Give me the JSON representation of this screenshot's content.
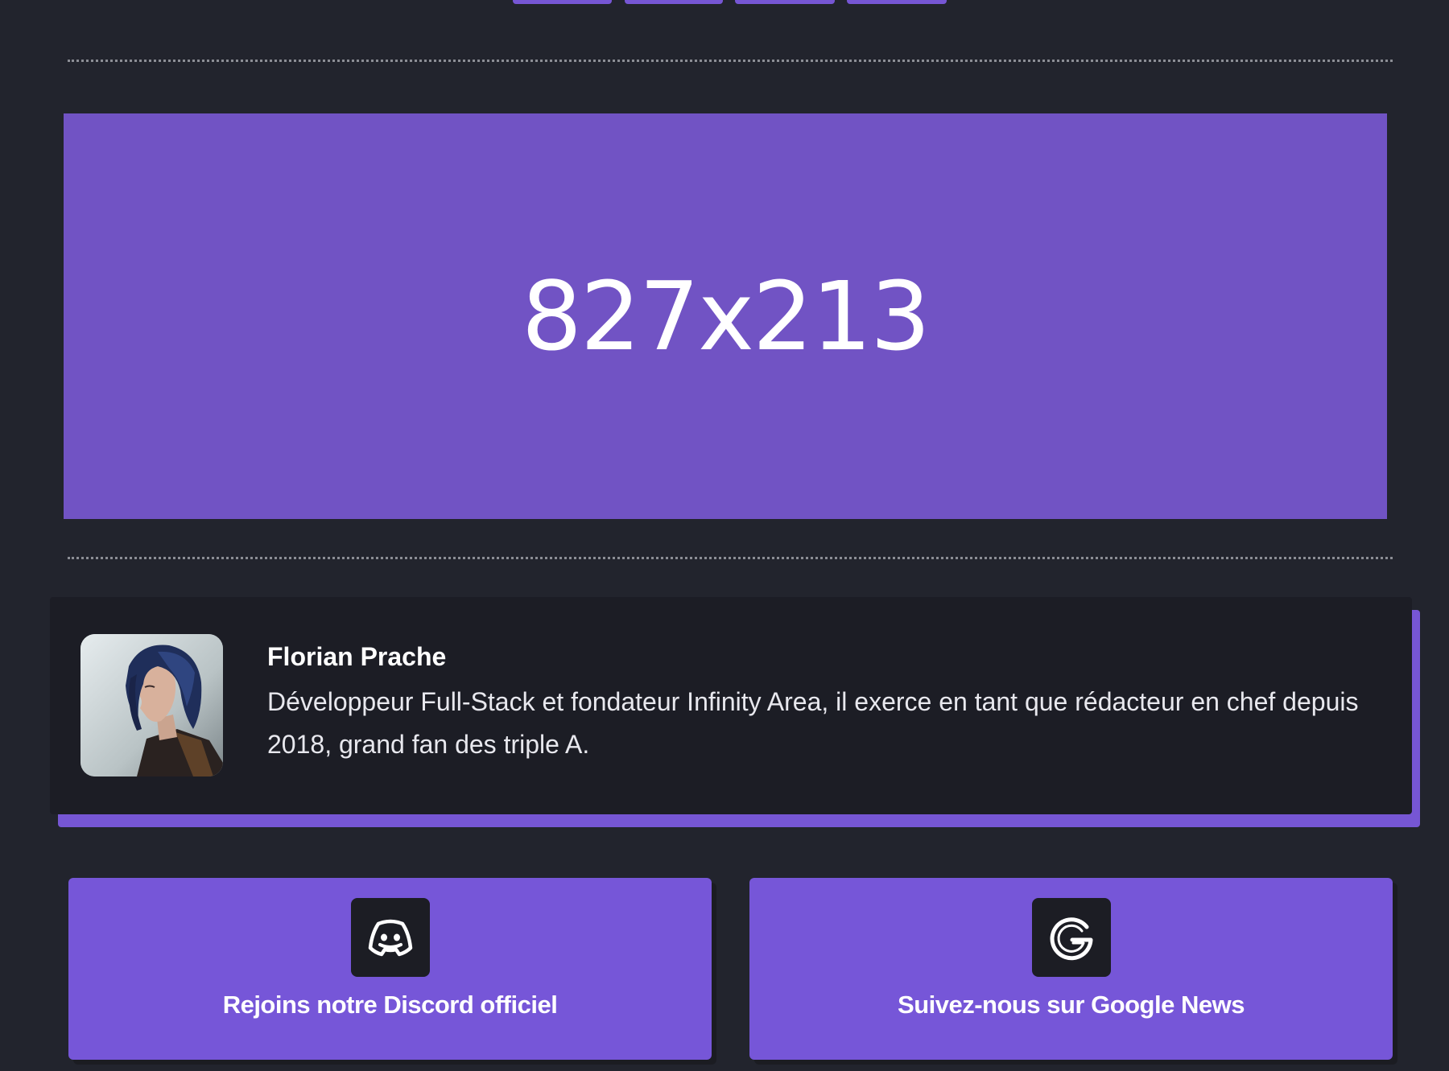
{
  "top_tabs": [
    {
      "label": ""
    },
    {
      "label": ""
    },
    {
      "label": ""
    },
    {
      "label": ""
    }
  ],
  "ad_banner": {
    "text": "827x213"
  },
  "author": {
    "name": "Florian Prache",
    "bio": "Développeur Full-Stack et fondateur Infinity Area, il exerce en tant que rédacteur en chef depuis 2018, grand fan des triple A.",
    "avatar_icon": "author-portrait"
  },
  "cta": {
    "discord": {
      "label": "Rejoins notre Discord officiel",
      "icon": "discord-icon"
    },
    "google_news": {
      "label": "Suivez-nous sur Google News",
      "icon": "google-icon"
    }
  },
  "colors": {
    "background": "#22242d",
    "accent": "#7656d4",
    "banner": "#7153c4",
    "card": "#1c1d25"
  }
}
